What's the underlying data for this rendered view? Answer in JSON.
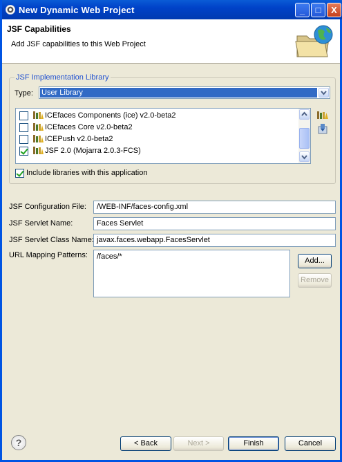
{
  "window": {
    "title": "New Dynamic Web Project",
    "controls": {
      "minimize": "_",
      "maximize": "□",
      "close": "X"
    }
  },
  "header": {
    "title": "JSF Capabilities",
    "description": "Add JSF capabilities to this Web Project",
    "graphic_icon": "folder-globe-icon"
  },
  "implementation_group": {
    "label": "JSF Implementation Library",
    "type_label": "Type:",
    "type_value": "User Library",
    "libraries": [
      {
        "label": "ICEfaces Components (ice) v2.0-beta2",
        "checked": false
      },
      {
        "label": "ICEfaces Core v2.0-beta2",
        "checked": false
      },
      {
        "label": "ICEPush v2.0-beta2",
        "checked": false
      },
      {
        "label": "JSF 2.0 (Mojarra 2.0.3-FCS)",
        "checked": true
      }
    ],
    "side_icons": [
      "manage-libraries-icon",
      "download-library-icon"
    ],
    "include_label": "Include libraries with this application",
    "include_checked": true
  },
  "fields": {
    "config_file_label": "JSF Configuration File:",
    "config_file_value": "/WEB-INF/faces-config.xml",
    "servlet_name_label": "JSF Servlet Name:",
    "servlet_name_value": "Faces Servlet",
    "servlet_class_label": "JSF Servlet Class Name:",
    "servlet_class_value": "javax.faces.webapp.FacesServlet",
    "url_patterns_label": "URL Mapping Patterns:",
    "url_patterns_value": "/faces/*",
    "add_label": "Add...",
    "remove_label": "Remove"
  },
  "footer": {
    "help_icon": "?",
    "back_label": "< Back",
    "next_label": "Next >",
    "finish_label": "Finish",
    "cancel_label": "Cancel"
  },
  "colors": {
    "titlebar": "#0042c8",
    "selection": "#316ac5",
    "group_label": "#2050d0",
    "dialog_bg": "#ece9d8"
  }
}
